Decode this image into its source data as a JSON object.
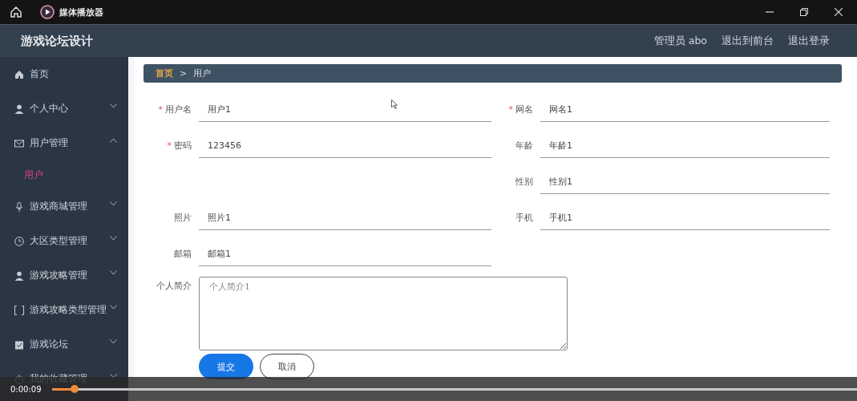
{
  "player": {
    "title": "媒体播放器",
    "time": "0:00:09",
    "level": 0.028
  },
  "app": {
    "title": "游戏论坛设计",
    "header_links": [
      "管理员 abo",
      "退出到前台",
      "退出登录"
    ]
  },
  "sidebar": {
    "items": [
      {
        "kind": "link",
        "label": "首页"
      },
      {
        "kind": "menu",
        "label": "个人中心",
        "expanded": false
      },
      {
        "kind": "menu",
        "label": "用户管理",
        "expanded": true,
        "children": [
          {
            "label": "用户",
            "selected": true
          }
        ]
      },
      {
        "kind": "menu",
        "label": "游戏商城管理",
        "expanded": false
      },
      {
        "kind": "menu",
        "label": "大区类型管理",
        "expanded": false
      },
      {
        "kind": "menu",
        "label": "游戏攻略管理",
        "expanded": false
      },
      {
        "kind": "menu",
        "label": "游戏攻略类型管理",
        "expanded": false
      },
      {
        "kind": "menu",
        "label": "游戏论坛",
        "expanded": false
      },
      {
        "kind": "menu",
        "label": "我的收藏管理",
        "expanded": false
      }
    ]
  },
  "breadcrumb": {
    "items": [
      "首页",
      "用户"
    ],
    "separator": ">"
  },
  "form": {
    "required_mark": "*",
    "rows": [
      {
        "left": {
          "label": "用户名",
          "required": true,
          "value": "用户1"
        },
        "right": {
          "label": "网名",
          "required": true,
          "value": "网名1"
        }
      },
      {
        "left": {
          "label": "密码",
          "required": true,
          "value": "123456"
        },
        "right": {
          "label": "年龄",
          "required": false,
          "value": "年龄1"
        }
      },
      {
        "right": {
          "label": "性别",
          "required": false,
          "value": "性别1"
        }
      },
      {
        "left": {
          "label": "照片",
          "required": false,
          "value": "照片1"
        },
        "right": {
          "label": "手机",
          "required": false,
          "value": "手机1"
        }
      },
      {
        "left": {
          "label": "邮箱",
          "required": false,
          "value": "邮箱1"
        }
      }
    ],
    "textarea": {
      "label": "个人简介",
      "value": "个人简介1"
    },
    "buttons": [
      {
        "kind": "primary",
        "label": "提交"
      },
      {
        "kind": "outline",
        "label": "取消"
      }
    ]
  }
}
